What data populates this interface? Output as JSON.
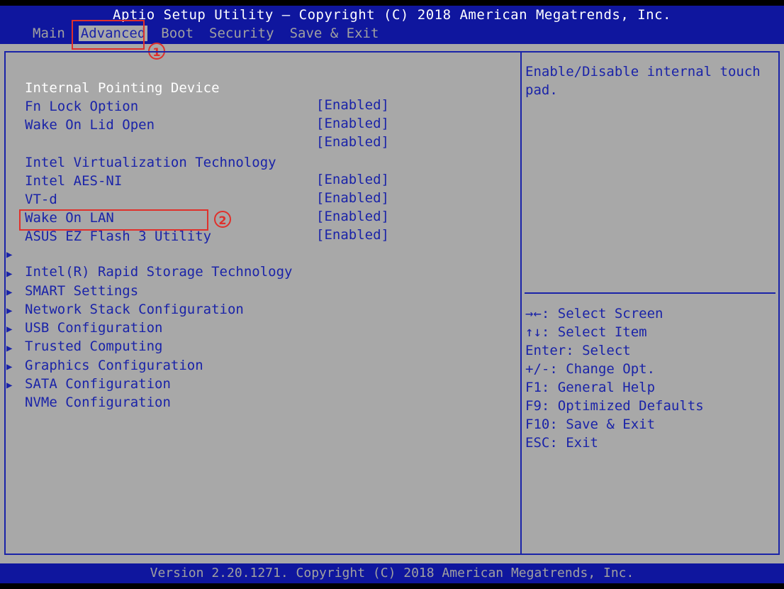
{
  "header": {
    "title": "Aptio Setup Utility – Copyright (C) 2018 American Megatrends, Inc.",
    "tabs": [
      "Main",
      "Advanced",
      "Boot",
      "Security",
      "Save & Exit"
    ]
  },
  "annotations": {
    "marker1": "1",
    "marker2": "2",
    "accent_color": "#e0302b"
  },
  "settings": [
    {
      "label": "Internal Pointing Device",
      "value": "[Enabled]"
    },
    {
      "label": "Fn Lock Option",
      "value": "[Enabled]"
    },
    {
      "label": "Wake On Lid Open",
      "value": "[Enabled]"
    },
    {
      "label": "Intel Virtualization Technology",
      "value": "[Enabled]"
    },
    {
      "label": "Intel AES-NI",
      "value": "[Enabled]"
    },
    {
      "label": "VT-d",
      "value": "[Enabled]"
    },
    {
      "label": "Wake On LAN",
      "value": "[Enabled]"
    }
  ],
  "ez_flash": "ASUS EZ Flash 3 Utility",
  "submenus": [
    "Intel(R) Rapid Storage Technology",
    "SMART Settings",
    "Network Stack Configuration",
    "USB Configuration",
    "Trusted Computing",
    "Graphics Configuration",
    "SATA Configuration",
    "NVMe Configuration"
  ],
  "help_text": "Enable/Disable internal touch pad.",
  "key_help": [
    "→←: Select Screen",
    "↑↓: Select Item",
    "Enter: Select",
    "+/-: Change Opt.",
    "F1: General Help",
    "F9: Optimized Defaults",
    "F10: Save & Exit",
    "ESC: Exit"
  ],
  "footer": "Version 2.20.1271. Copyright (C) 2018 American Megatrends, Inc.",
  "colors": {
    "bar_blue": "#0f169e",
    "panel_gray": "#a8a8a8",
    "text_blue": "#1a23a8"
  }
}
